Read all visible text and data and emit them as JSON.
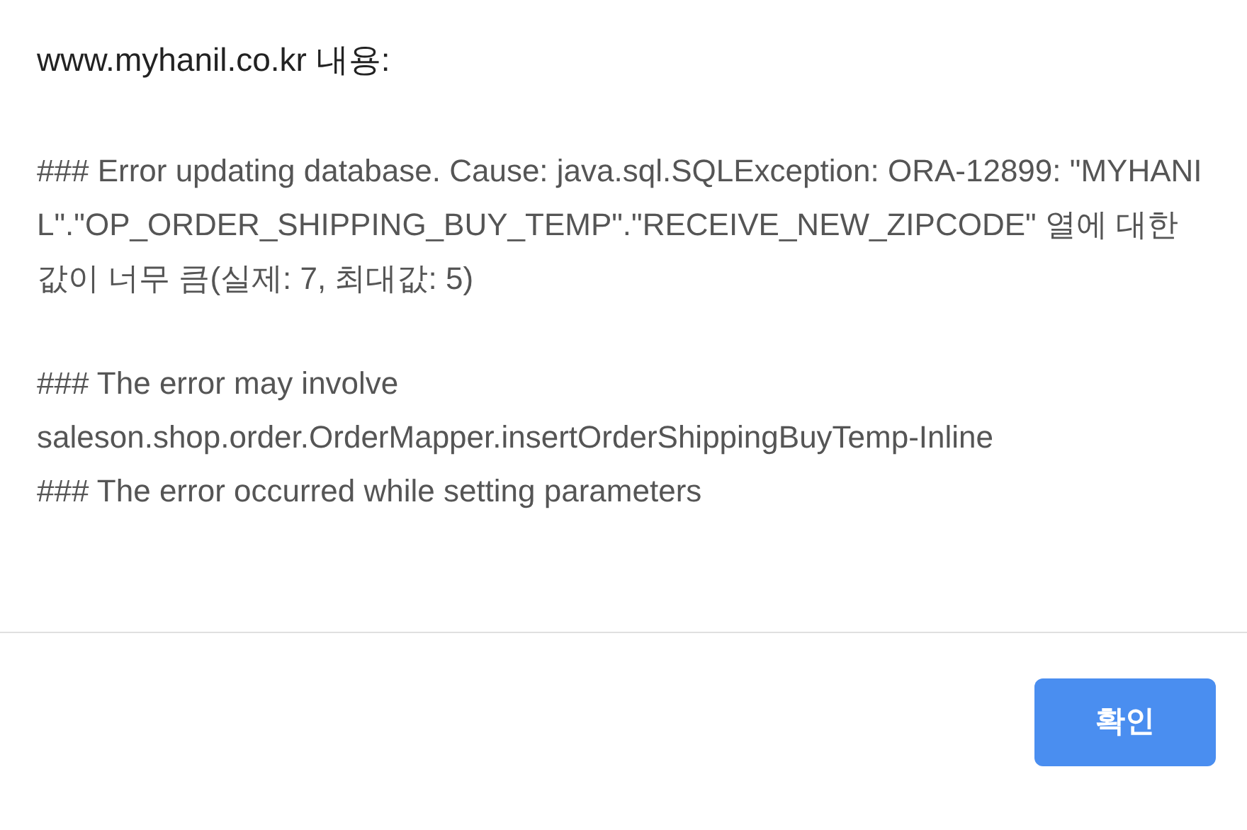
{
  "dialog": {
    "title": "www.myhanil.co.kr 내용:",
    "message_blocks": [
      [
        "### Error updating database.  Cause: java.sql.SQLException: ORA-12899: \"MYHANIL\".\"OP_ORDER_SHIPPING_BUY_TEMP\".\"RECEIVE_NEW_ZIPCODE\" 열에 대한 값이 너무 큼(실제: 7, 최대값: 5)"
      ],
      [
        "### The error may involve",
        "saleson.shop.order.OrderMapper.insertOrderShippingBuyTemp-Inline",
        "### The error occurred while setting parameters"
      ]
    ],
    "buttons": [
      "확인"
    ]
  }
}
